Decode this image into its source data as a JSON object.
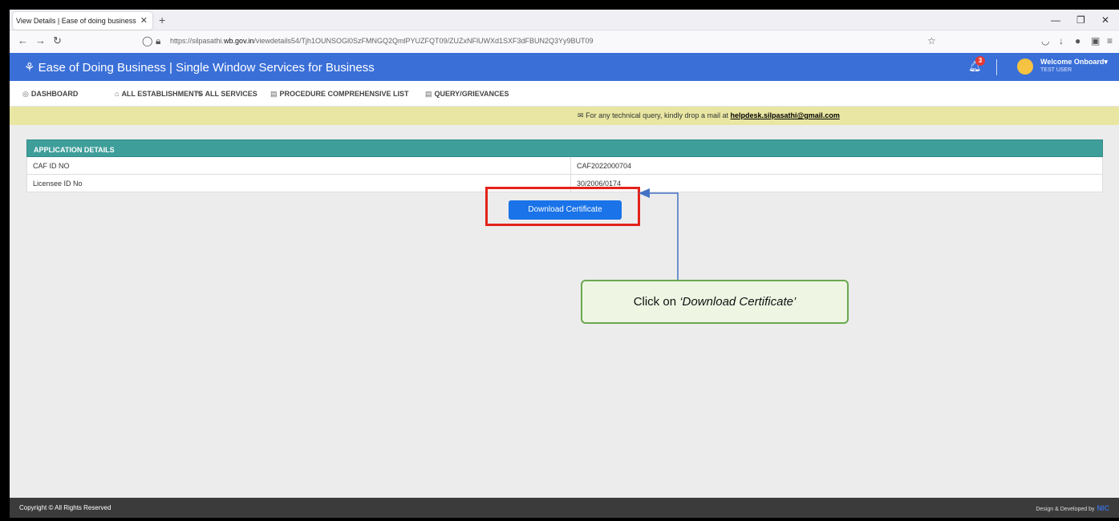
{
  "browser": {
    "tab_title": "View Details | Ease of doing business",
    "tab_close": "✕",
    "new_tab": "+",
    "url_prefix": "https://silpasathi.",
    "url_domain": "wb.gov.in",
    "url_rest": "/viewdetails54/Tjh1OUNSOGl0SzFMNGQ2QmlPYUZFQT09/ZUZxNFlUWXd1SXF3dFBUN2Q3Yy9BUT09"
  },
  "app": {
    "title": "Ease of Doing Business | Single Window Services for Business",
    "notification_count": "3",
    "welcome": "Welcome Onboard",
    "user": "TEST USER"
  },
  "menu": [
    {
      "label": "DASHBOARD",
      "icon": "dashboard-icon"
    },
    {
      "label": "ALL ESTABLISHMENTS",
      "icon": "building-icon"
    },
    {
      "label": "ALL SERVICES",
      "icon": "wrench-icon"
    },
    {
      "label": "PROCEDURE COMPREHENSIVE LIST",
      "icon": "list-icon"
    },
    {
      "label": "QUERY/GRIEVANCES",
      "icon": "list-icon"
    }
  ],
  "notice": {
    "text": "For any technical query, kindly drop a mail at",
    "email": "helpdesk.silpasathi@gmail.com"
  },
  "application": {
    "heading": "APPLICATION DETAILS",
    "rows": [
      {
        "key": "CAF ID NO",
        "value": "CAF2022000704"
      },
      {
        "key": "Licensee ID No",
        "value": "30/2006/0174"
      }
    ],
    "download_label": "Download Certificate"
  },
  "callout": {
    "prefix": "Click on ",
    "emphasis": "‘Download Certificate’"
  },
  "footer": {
    "left": "Copyright © All Rights Reserved",
    "right": "Design & Developed by",
    "brand": "NIC"
  },
  "colors": {
    "header_blue": "#3a6fd8",
    "table_teal": "#3e9e9a",
    "highlight_red": "#e32219",
    "callout_green": "#6aa84f"
  }
}
